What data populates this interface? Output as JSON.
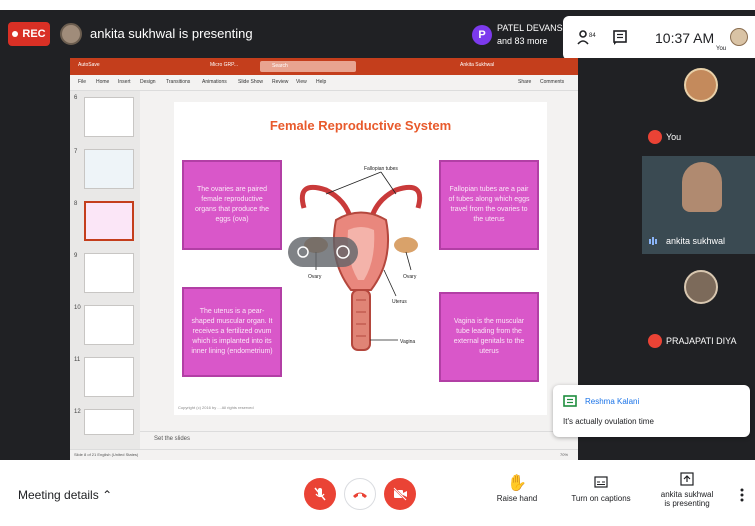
{
  "recording": {
    "label": "REC"
  },
  "presenter": {
    "text": "ankita sukhwal is presenting"
  },
  "participants_summary": {
    "initial": "P",
    "line1": "PATEL DEVANSHI",
    "line2": "and 83 more"
  },
  "clock": {
    "time": "10:37 AM",
    "self_label": "You"
  },
  "ppt": {
    "autosave": "AutoSave",
    "filename": "Micro GRP...",
    "search_placeholder": "Search",
    "user": "Ankita Sukhwal",
    "menus": [
      "File",
      "Home",
      "Insert",
      "Design",
      "Transitions",
      "Animations",
      "Slide Show",
      "Review",
      "View",
      "Help"
    ],
    "share": "Share",
    "comments": "Comments",
    "thumb_numbers": [
      "6",
      "7",
      "8",
      "9",
      "10",
      "11",
      "12"
    ],
    "notes": "Set the slides",
    "status": "Slide 8 of 21    English (United States)",
    "zoom": "70%"
  },
  "slide": {
    "title": "Female Reproductive System",
    "box_ovaries": "The ovaries are paired female reproductive organs that produce the eggs (ova)",
    "box_fallopian": "Fallopian tubes are a pair of tubes along which eggs travel from the ovaries to the uterus",
    "box_uterus": "The uterus is a pear-shaped muscular organ. It receives a fertilized ovum which is implanted into its inner lining (endometrium)",
    "box_vagina": "Vagina is the muscular tube leading from the external genitals to the uterus",
    "label_fallopian": "Fallopian tubes",
    "label_ovary_left": "Ovary",
    "label_ovary_right": "Ovary",
    "label_uterus": "Uterus",
    "label_vagina": "Vagina",
    "copyright": "Copyright (c) 2016 by ... All rights reserved"
  },
  "tiles": [
    {
      "name": "You"
    },
    {
      "name": "ankita sukhwal"
    },
    {
      "name": "PRAJAPATI DIYA"
    }
  ],
  "chat": {
    "sender": "Reshma Kalani",
    "message": "It's actually ovulation time"
  },
  "controls": {
    "meeting_details": "Meeting details",
    "raise_hand": "Raise hand",
    "captions": "Turn on captions",
    "presenting_line1": "ankita sukhwal",
    "presenting_line2": "is presenting"
  },
  "colors": {
    "rec": "#d93025",
    "ppt_brand": "#c43e1c",
    "slide_box": "#d957c9",
    "title": "#e85a2c",
    "danger": "#ea4335"
  }
}
